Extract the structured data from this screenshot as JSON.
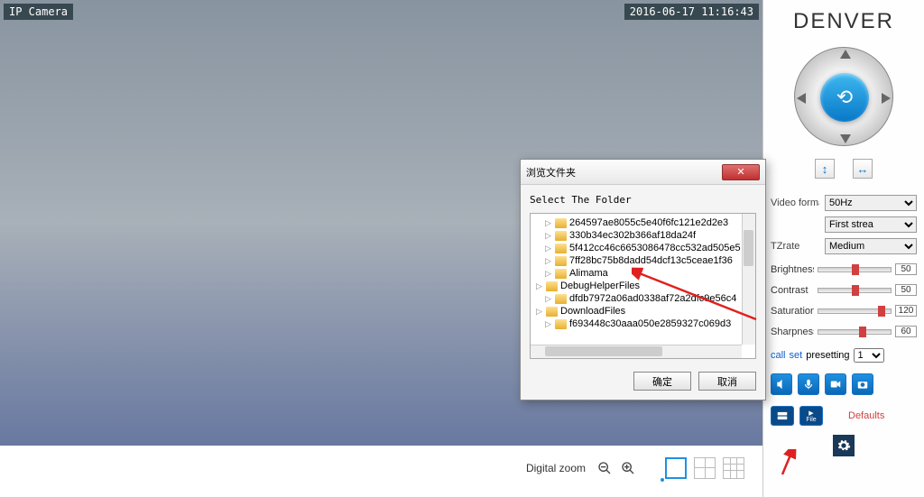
{
  "camera": {
    "label": "IP Camera",
    "timestamp": "2016-06-17 11:16:43"
  },
  "toolbar": {
    "digital_zoom_label": "Digital zoom"
  },
  "panel": {
    "logo": "DENVER",
    "video_format_label": "Video format",
    "video_format_value": "50Hz",
    "stream_value": "First strea",
    "ptzrate_label": "TZrate",
    "ptzrate_value": "Medium",
    "brightness_label": "Brightness",
    "brightness_value": "50",
    "contrast_label": "Contrast",
    "contrast_value": "50",
    "saturation_label": "Saturation",
    "saturation_value": "120",
    "sharpness_label": "Sharpness",
    "sharpness_value": "60",
    "preset_call": "call",
    "preset_set": "set",
    "preset_label": "presetting",
    "preset_value": "1",
    "defaults_label": "Defaults",
    "file_label": "File"
  },
  "dialog": {
    "title": "浏览文件夹",
    "instruction": "Select The Folder",
    "items": [
      "264597ae8055c5e40f6fc121e2d2e3",
      "330b34ec302b366af18da24f",
      "5f412cc46c6653086478cc532ad505e5",
      "7ff28bc75b8dadd54dcf13c5ceae1f36",
      "Alimama",
      "DebugHelperFiles",
      "dfdb7972a06ad0338af72a2dfc9e56c4",
      "DownloadFiles",
      "f693448c30aaa050e2859327c069d3"
    ],
    "ok": "确定",
    "cancel": "取消"
  }
}
